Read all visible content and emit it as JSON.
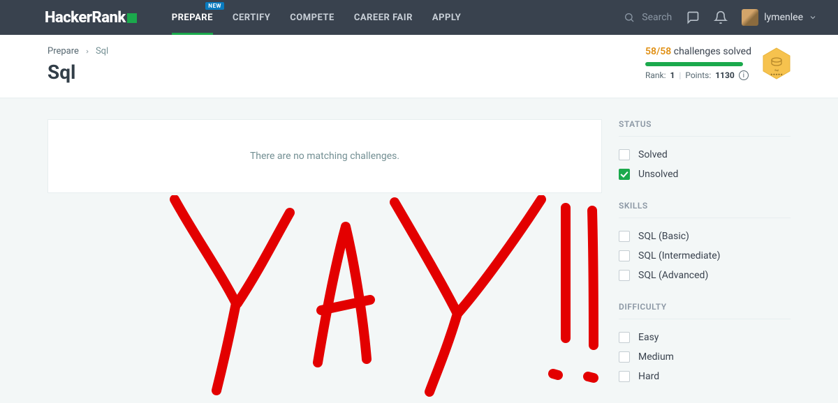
{
  "brand": {
    "name": "HackerRank"
  },
  "nav": {
    "items": [
      {
        "label": "PREPARE",
        "badge": "NEW",
        "active": true
      },
      {
        "label": "CERTIFY"
      },
      {
        "label": "COMPETE"
      },
      {
        "label": "CAREER FAIR"
      },
      {
        "label": "APPLY"
      }
    ]
  },
  "search": {
    "placeholder": "Search"
  },
  "user": {
    "name": "lymenlee"
  },
  "breadcrumb": {
    "root": "Prepare",
    "current": "Sql"
  },
  "page": {
    "title": "Sql"
  },
  "stats": {
    "solved": "58/58",
    "solved_label": "challenges solved",
    "rank_label": "Rank:",
    "rank": "1",
    "points_label": "Points:",
    "points": "1130"
  },
  "badge": {
    "label": "Sql"
  },
  "main": {
    "empty_message": "There are no matching challenges."
  },
  "filters": {
    "status": {
      "title": "STATUS",
      "items": [
        {
          "label": "Solved",
          "checked": false
        },
        {
          "label": "Unsolved",
          "checked": true
        }
      ]
    },
    "skills": {
      "title": "SKILLS",
      "items": [
        {
          "label": "SQL (Basic)",
          "checked": false
        },
        {
          "label": "SQL (Intermediate)",
          "checked": false
        },
        {
          "label": "SQL (Advanced)",
          "checked": false
        }
      ]
    },
    "difficulty": {
      "title": "DIFFICULTY",
      "items": [
        {
          "label": "Easy",
          "checked": false
        },
        {
          "label": "Medium",
          "checked": false
        },
        {
          "label": "Hard",
          "checked": false
        }
      ]
    }
  },
  "annotation": {
    "text": "YAY!!"
  }
}
